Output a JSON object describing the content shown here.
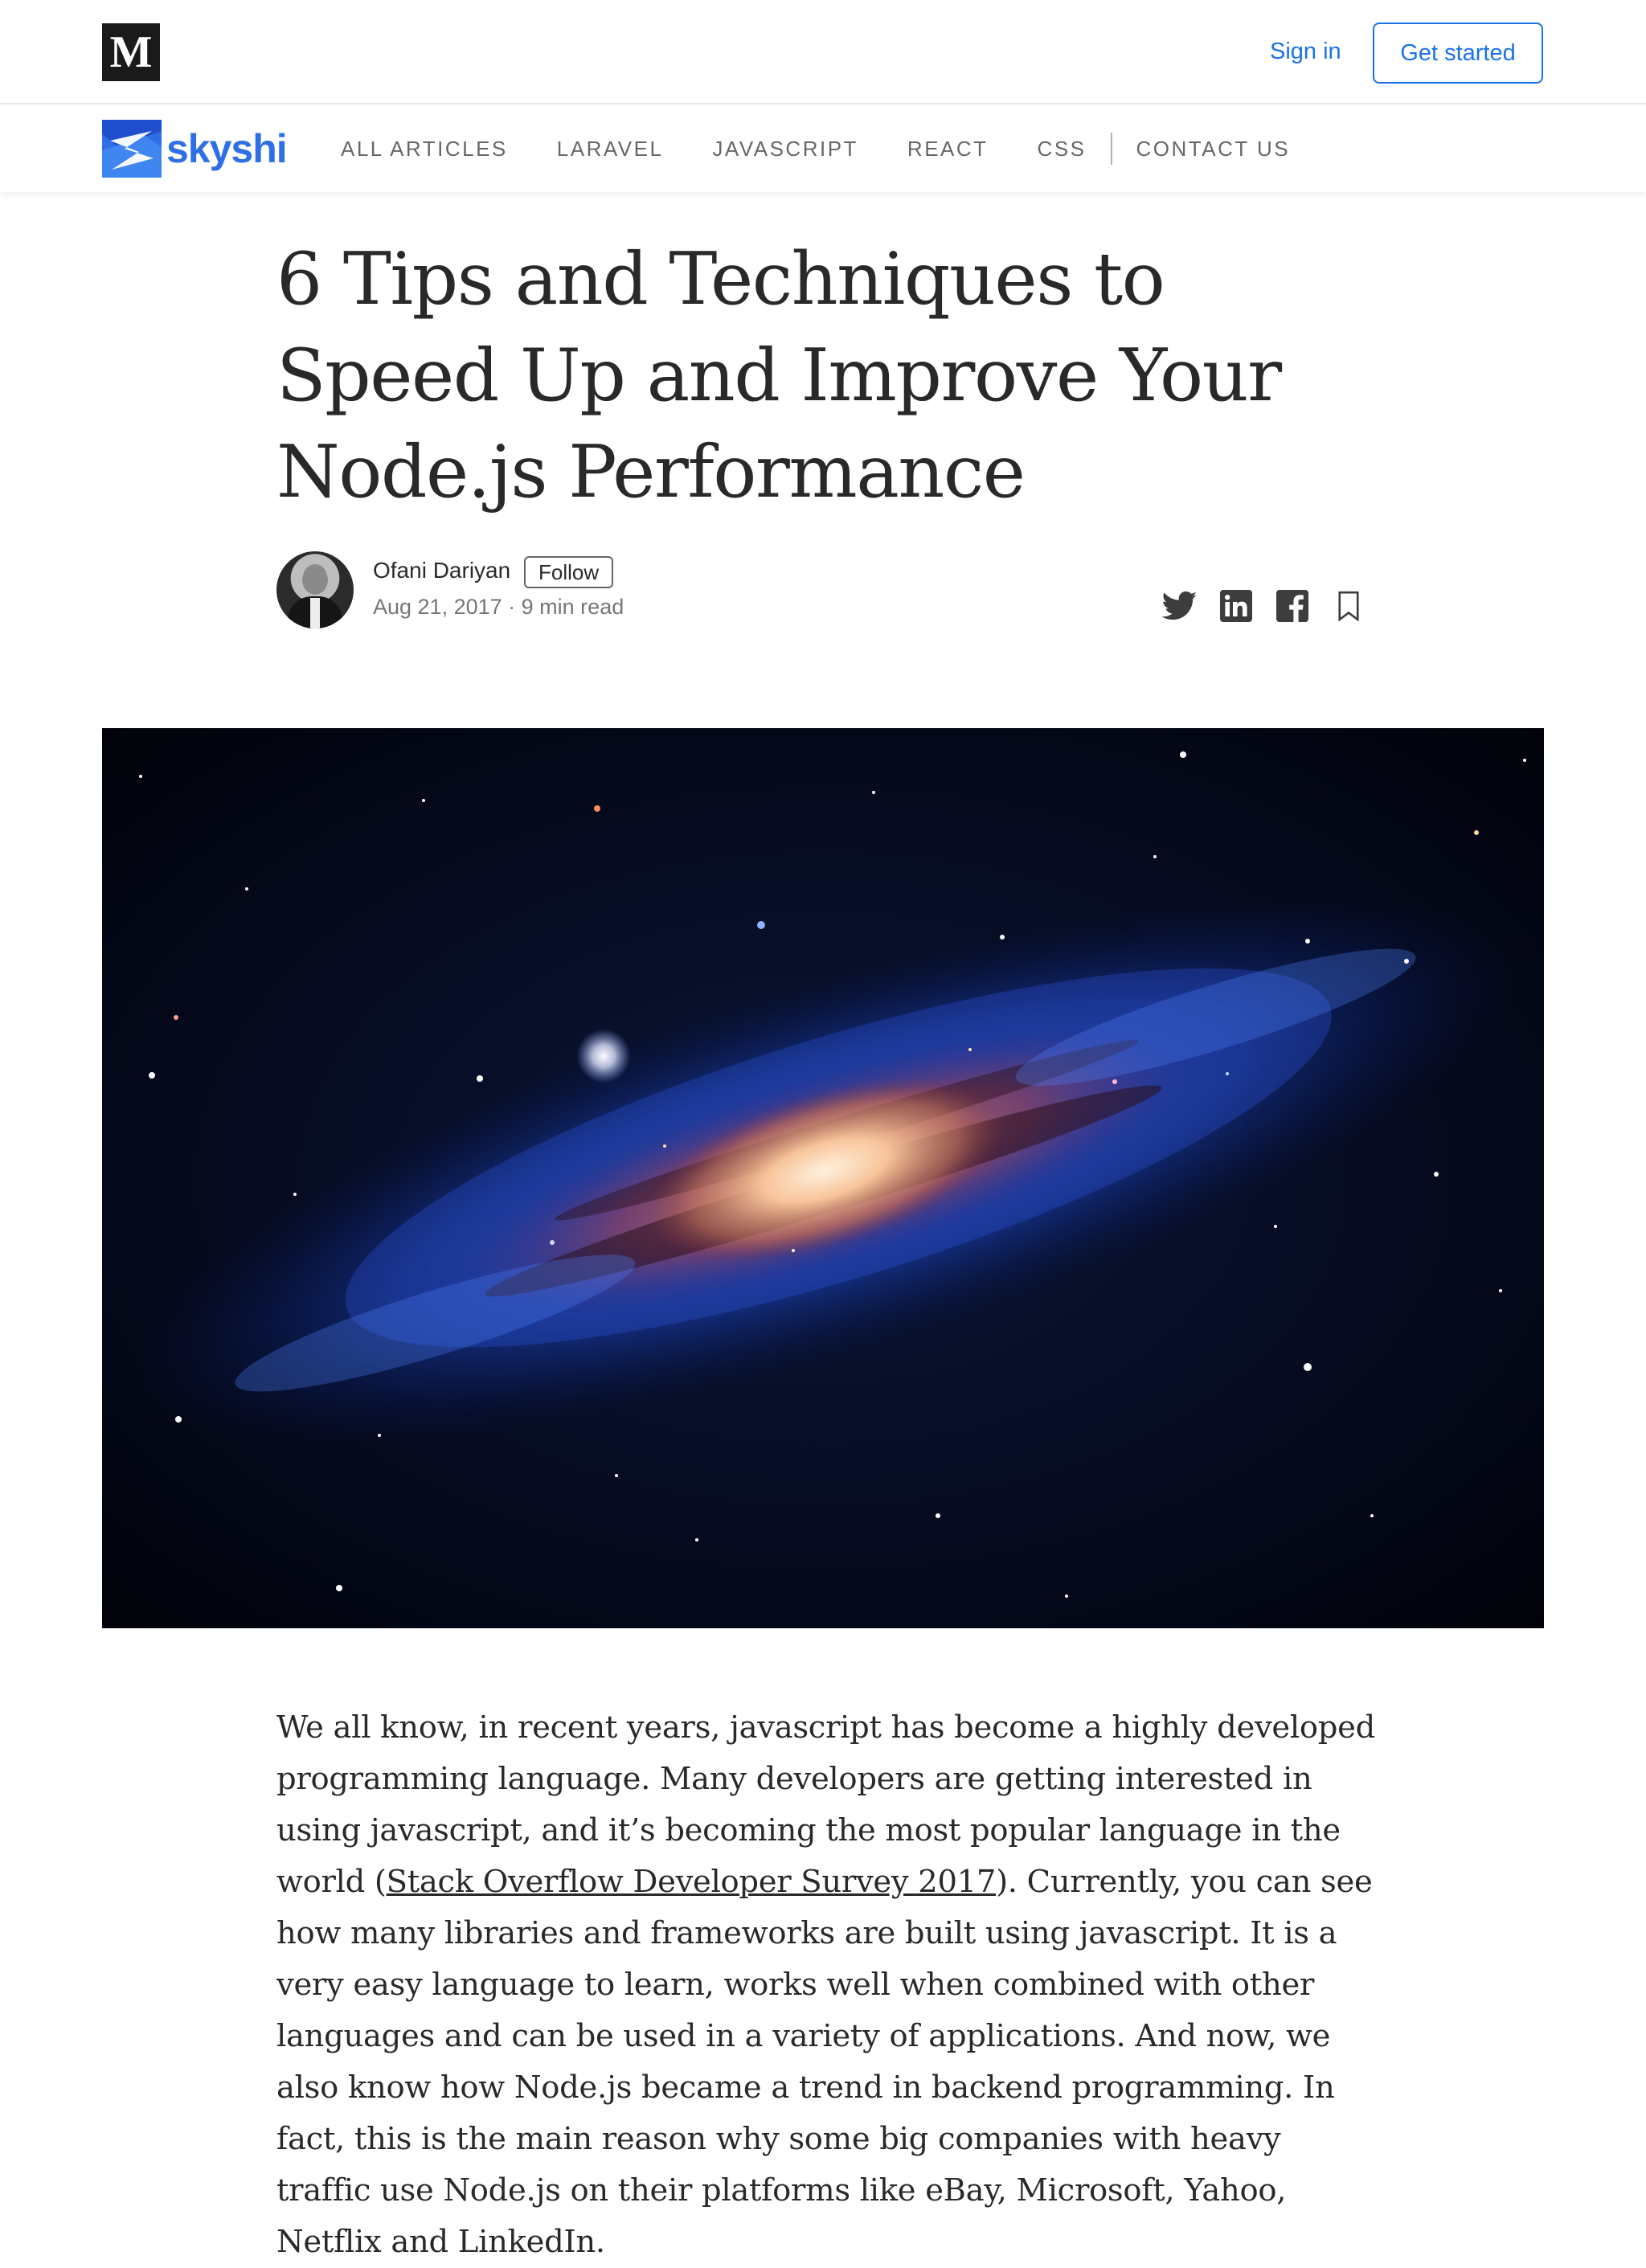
{
  "topbar": {
    "logo_letter": "M",
    "signin_label": "Sign in",
    "getstarted_label": "Get started"
  },
  "publication": {
    "name": "skyshi",
    "nav": [
      "ALL ARTICLES",
      "LARAVEL",
      "JAVASCRIPT",
      "REACT",
      "CSS"
    ],
    "contact": "CONTACT US"
  },
  "article": {
    "title": "6 Tips and Techniques to Speed Up and Improve Your Node.js Performance",
    "author": "Ofani Dariyan",
    "follow_label": "Follow",
    "date": "Aug 21, 2017",
    "read_time": "9 min read",
    "body_before_link": "We all know, in recent years, javascript has become a highly developed programming language. Many developers are getting interested in using javascript, and it’s becoming the most popular language in the world (",
    "body_link": "Stack Overflow Developer Survey 2017",
    "body_after_link": "). Currently, you can see how many libraries and frameworks are built using javascript. It is a very easy language to learn, works well when combined with other languages and can be used in a variety of applications. And now, we also know how Node.js became a trend in backend programming. In fact, this is the main reason why some big companies with heavy traffic use Node.js on their platforms like eBay, Microsoft, Yahoo, Netflix and LinkedIn."
  },
  "icons": {
    "share": [
      "twitter-icon",
      "linkedin-icon",
      "facebook-icon",
      "bookmark-icon"
    ]
  },
  "colors": {
    "accent": "#1a73e8",
    "brand": "#2f6fe6"
  }
}
